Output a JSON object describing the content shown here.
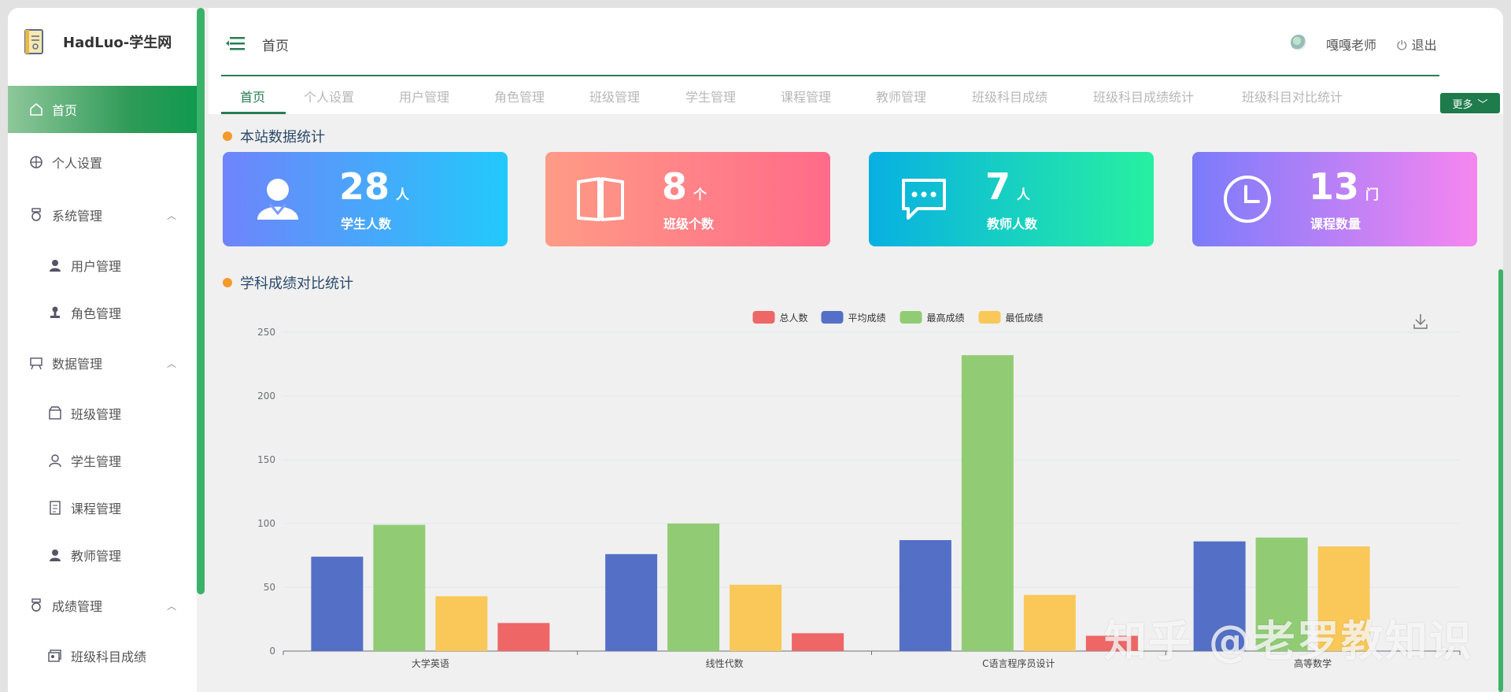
{
  "app": {
    "title": "HadLuo-学生网"
  },
  "sidebar": {
    "items": [
      {
        "label": "首页",
        "icon": "home-icon"
      },
      {
        "label": "个人设置",
        "icon": "basketball-icon"
      },
      {
        "label": "系统管理",
        "icon": "medal-icon"
      },
      {
        "label": "用户管理",
        "icon": "user-icon"
      },
      {
        "label": "角色管理",
        "icon": "stamp-icon"
      },
      {
        "label": "数据管理",
        "icon": "easel-icon"
      },
      {
        "label": "班级管理",
        "icon": "box-icon"
      },
      {
        "label": "学生管理",
        "icon": "person-outline-icon"
      },
      {
        "label": "课程管理",
        "icon": "document-icon"
      },
      {
        "label": "教师管理",
        "icon": "user-icon"
      },
      {
        "label": "成绩管理",
        "icon": "medal-icon"
      },
      {
        "label": "班级科目成绩",
        "icon": "picture-icon"
      }
    ]
  },
  "header": {
    "breadcrumb": "首页",
    "user_name": "嘎嘎老师",
    "logout_label": "退出",
    "more_label": "更多"
  },
  "tabs": [
    {
      "label": "首页"
    },
    {
      "label": "个人设置"
    },
    {
      "label": "用户管理"
    },
    {
      "label": "角色管理"
    },
    {
      "label": "班级管理"
    },
    {
      "label": "学生管理"
    },
    {
      "label": "课程管理"
    },
    {
      "label": "教师管理"
    },
    {
      "label": "班级科目成绩"
    },
    {
      "label": "班级科目成绩统计"
    },
    {
      "label": "班级科目对比统计"
    }
  ],
  "stats": {
    "title": "本站数据统计",
    "cards": [
      {
        "value": "28",
        "unit": "人",
        "label": "学生人数",
        "icon": "person-icon"
      },
      {
        "value": "8",
        "unit": "个",
        "label": "班级个数",
        "icon": "book-icon"
      },
      {
        "value": "7",
        "unit": "人",
        "label": "教师人数",
        "icon": "chat-icon"
      },
      {
        "value": "13",
        "unit": "门",
        "label": "课程数量",
        "icon": "clock-icon"
      }
    ]
  },
  "chart_section": {
    "title": "学科成绩对比统计"
  },
  "chart_data": {
    "type": "bar",
    "categories": [
      "大学英语",
      "线性代数",
      "C语言程序员设计",
      "高等数学"
    ],
    "series": [
      {
        "name": "平均成绩",
        "color": "#5470c6",
        "values": [
          74,
          76,
          87,
          86
        ]
      },
      {
        "name": "最高成绩",
        "color": "#91cc75",
        "values": [
          99,
          100,
          232,
          89
        ]
      },
      {
        "name": "最低成绩",
        "color": "#fac858",
        "values": [
          43,
          52,
          44,
          82
        ]
      },
      {
        "name": "总人数",
        "color": "#ee6666",
        "values": [
          22,
          14,
          12,
          0
        ]
      }
    ],
    "legend": [
      "总人数",
      "平均成绩",
      "最高成绩",
      "最低成绩"
    ],
    "legend_colors": [
      "#ee6666",
      "#5470c6",
      "#91cc75",
      "#fac858"
    ],
    "ylim": [
      0,
      250
    ],
    "yticks": [
      0,
      50,
      100,
      150,
      200,
      250
    ],
    "grid": true,
    "legend_position": "top-center"
  },
  "watermark": "知乎 @老罗教知识"
}
